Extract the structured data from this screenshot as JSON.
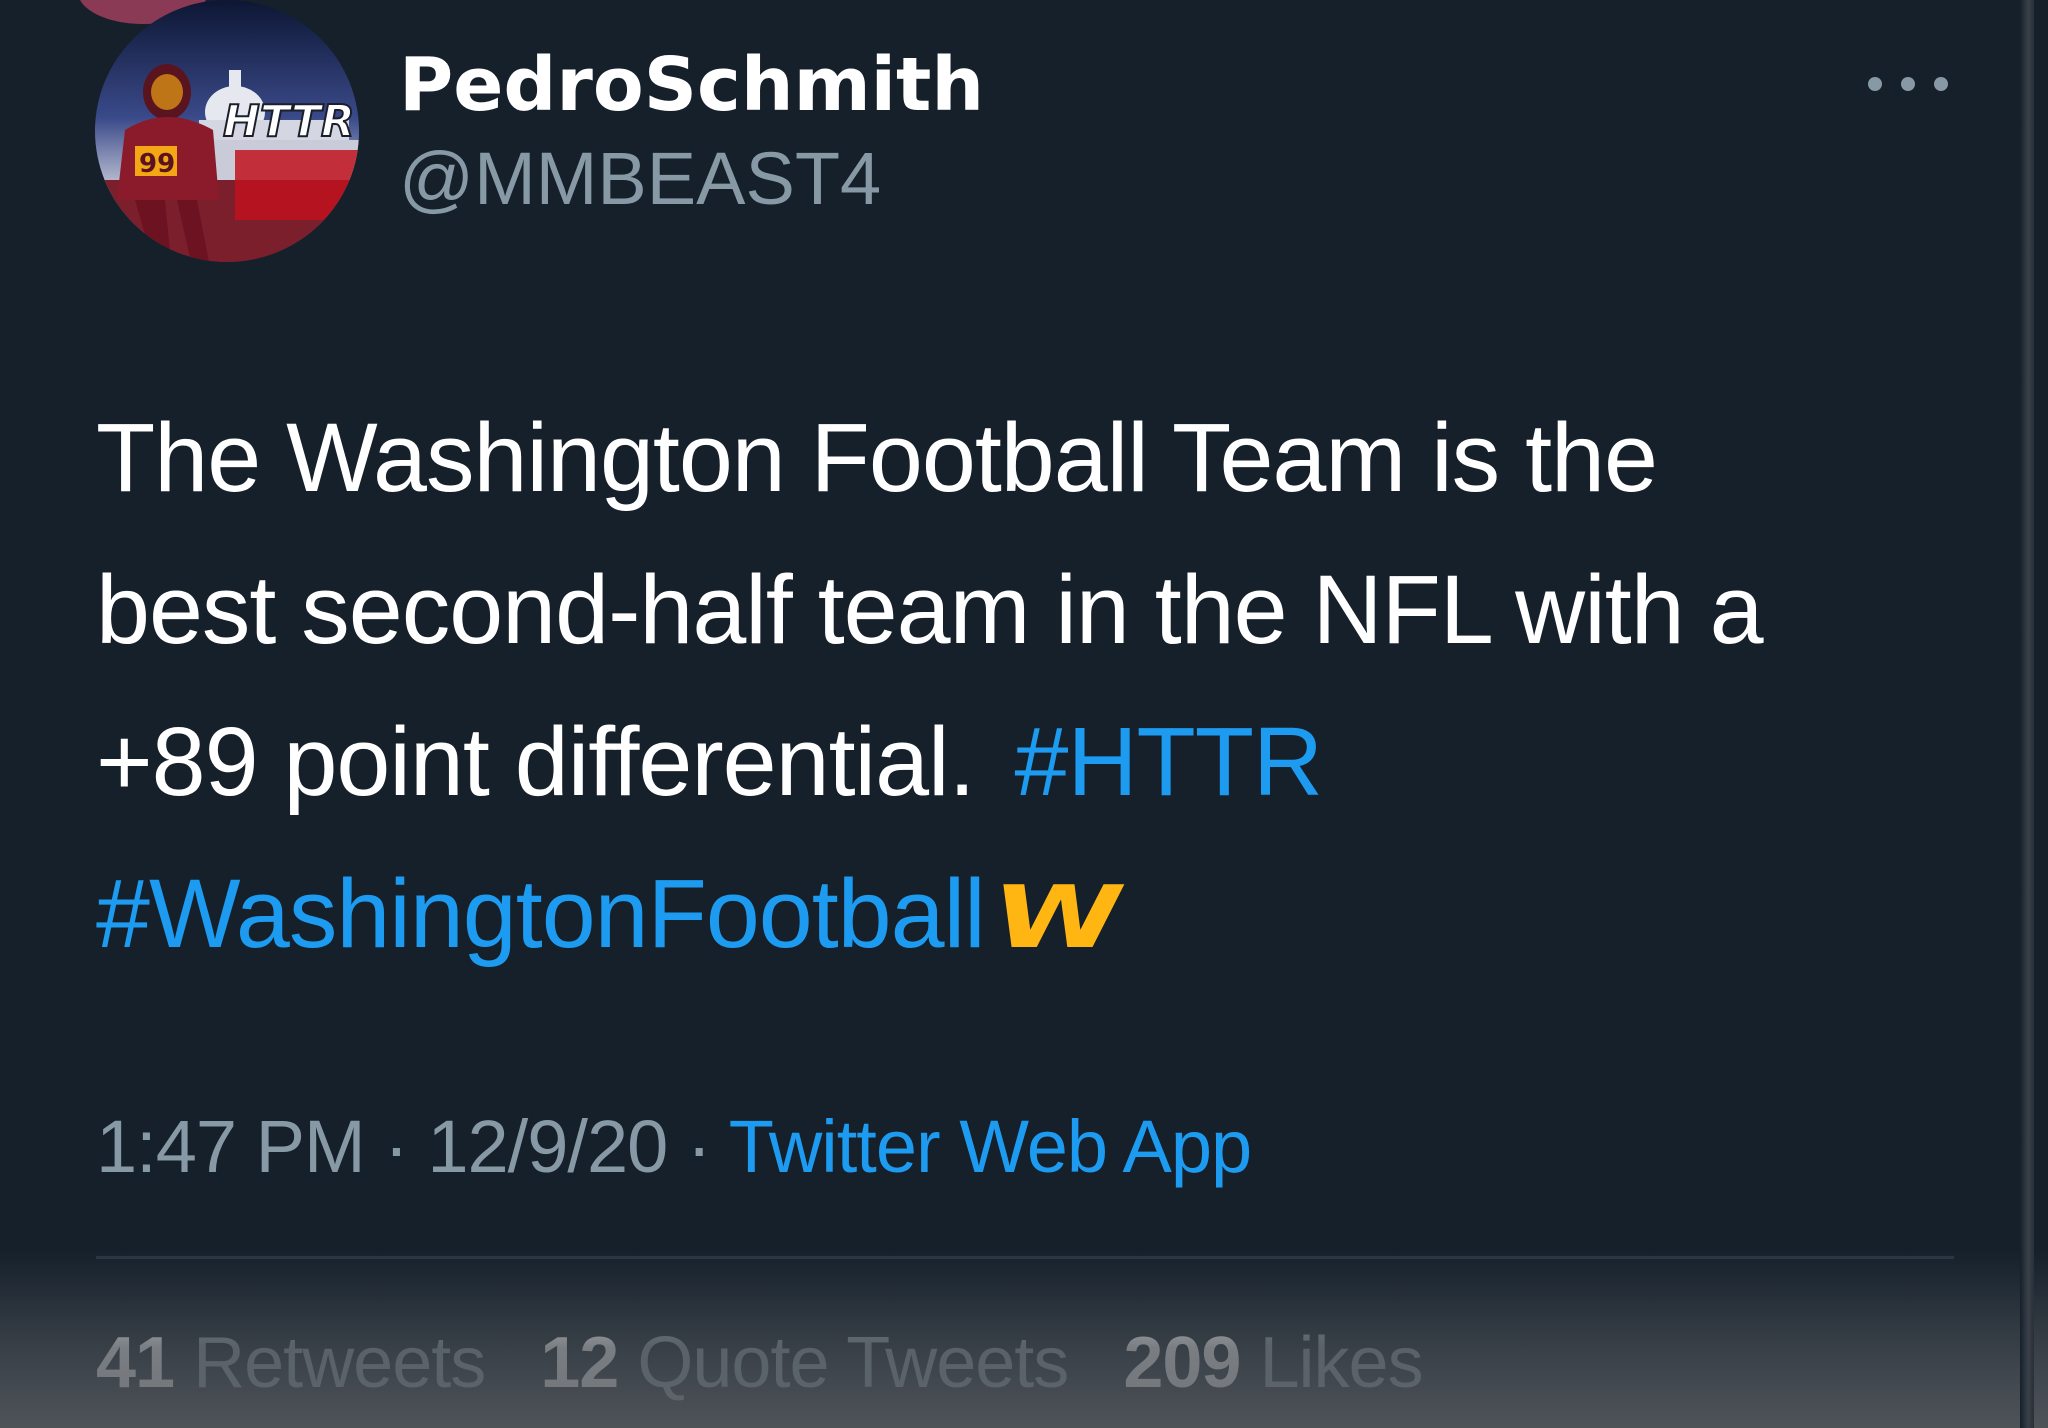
{
  "tweet": {
    "author": {
      "display_name": "PedroSchmith",
      "handle": "@MMBEAST4",
      "avatar_text": "HTTR",
      "jersey_number": "99"
    },
    "text_lines": [
      "The Washington Football Team is the",
      "best second-half team in the NFL with a",
      "+89 point differential."
    ],
    "hashtags": [
      "#HTTR",
      "#WashingtonFootball"
    ],
    "emoji_logo": "W",
    "time": "1:47 PM",
    "date": "12/9/20",
    "separator": "·",
    "source": "Twitter Web App",
    "stats": {
      "retweets_count": "41",
      "retweets_label": "Retweets",
      "quote_tweets_count": "12",
      "quote_tweets_label": "Quote Tweets",
      "likes_count": "209",
      "likes_label": "Likes"
    }
  },
  "colors": {
    "background": "#15202b",
    "hashtag": "#1d9bf0",
    "secondary_text": "#8899a6",
    "team_gold": "#ffb612",
    "team_burgundy": "#7a1f2b"
  },
  "icons": {
    "more": "more-horizontal-icon"
  }
}
